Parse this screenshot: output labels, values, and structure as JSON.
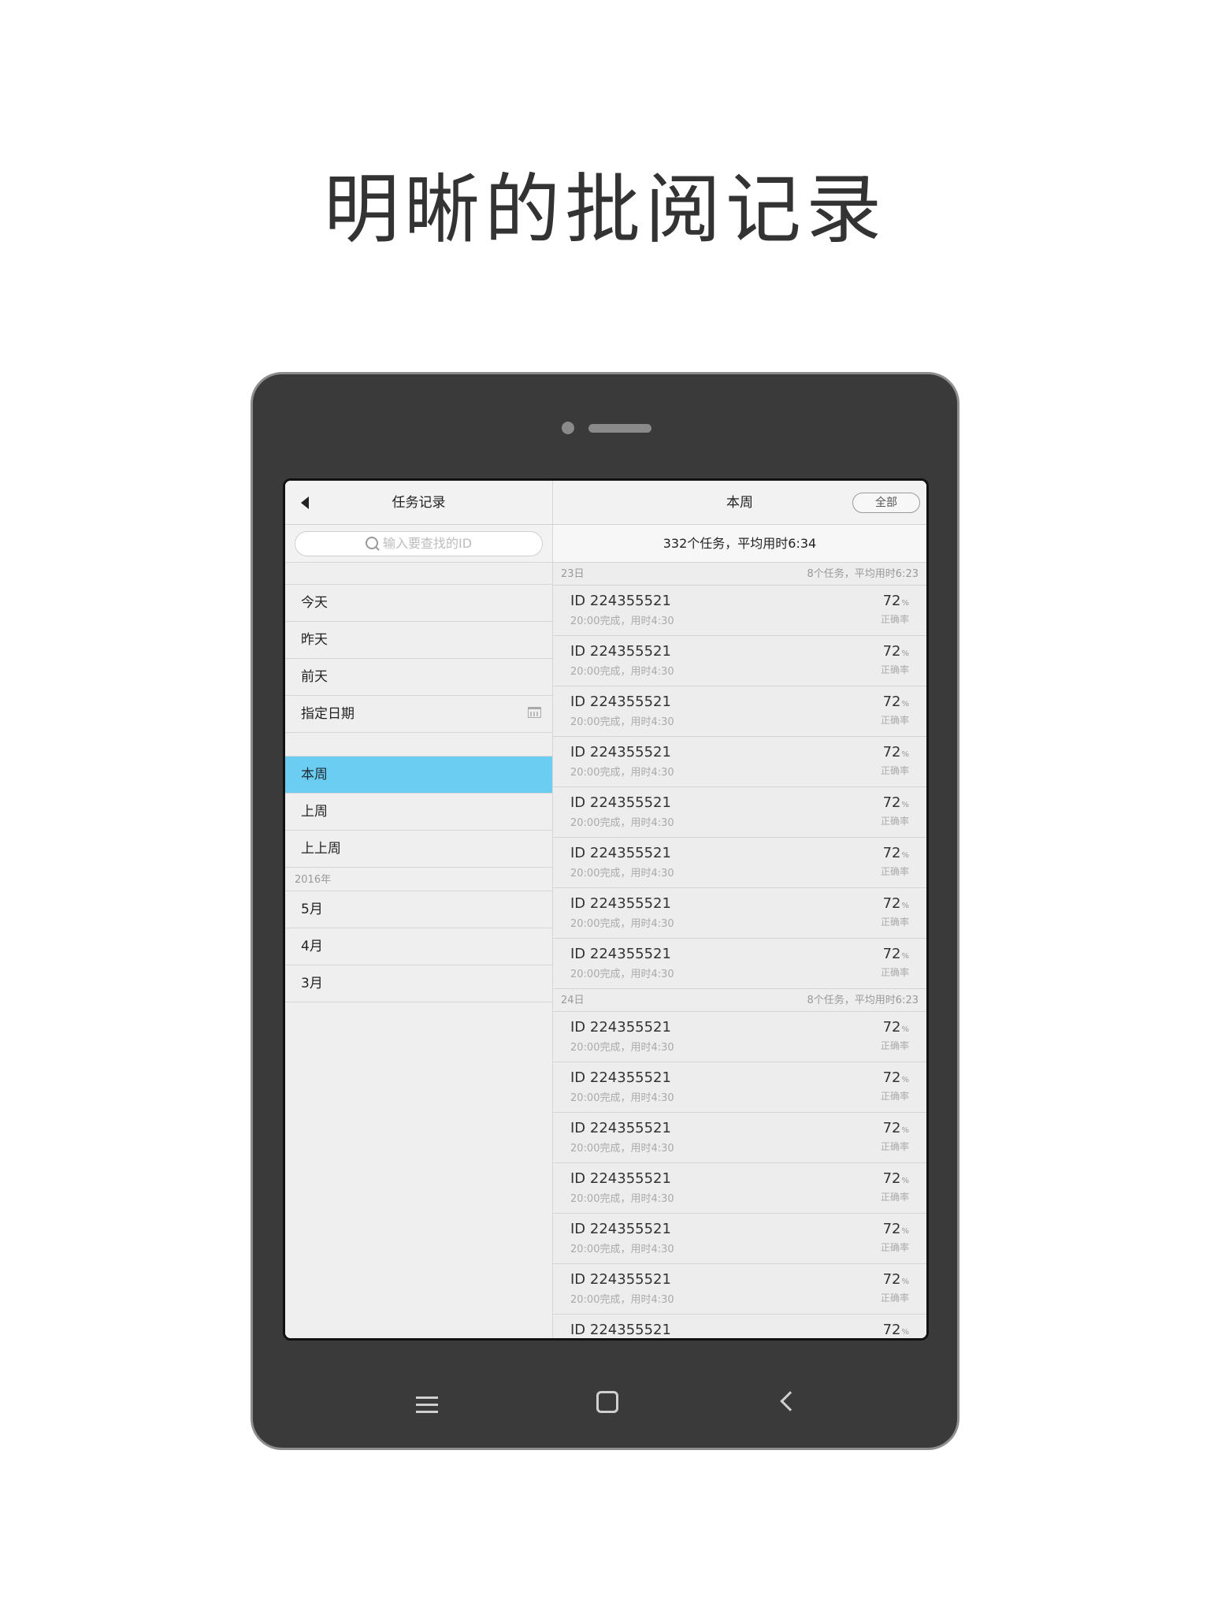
{
  "headline": "明晰的批阅记录",
  "sidebar": {
    "title": "任务记录",
    "search_placeholder": "输入要查找的ID",
    "items_recent": [
      {
        "label": "今天"
      },
      {
        "label": "昨天"
      },
      {
        "label": "前天"
      },
      {
        "label": "指定日期",
        "icon": "calendar-icon"
      }
    ],
    "items_weeks": [
      {
        "label": "本周",
        "active": true
      },
      {
        "label": "上周"
      },
      {
        "label": "上上周"
      }
    ],
    "year_header": "2016年",
    "items_months": [
      {
        "label": "5月"
      },
      {
        "label": "4月"
      },
      {
        "label": "3月"
      }
    ]
  },
  "main": {
    "title": "本周",
    "all_button": "全部",
    "summary": "332个任务，平均用时6:34",
    "groups": [
      {
        "day": "23日",
        "summary": "8个任务，平均用时6:23",
        "rows": [
          {
            "id": "ID 224355521",
            "sub": "20:00完成，用时4:30",
            "pct": "72",
            "unit": "%",
            "acc": "正确率"
          },
          {
            "id": "ID 224355521",
            "sub": "20:00完成，用时4:30",
            "pct": "72",
            "unit": "%",
            "acc": "正确率"
          },
          {
            "id": "ID 224355521",
            "sub": "20:00完成，用时4:30",
            "pct": "72",
            "unit": "%",
            "acc": "正确率"
          },
          {
            "id": "ID 224355521",
            "sub": "20:00完成，用时4:30",
            "pct": "72",
            "unit": "%",
            "acc": "正确率"
          },
          {
            "id": "ID 224355521",
            "sub": "20:00完成，用时4:30",
            "pct": "72",
            "unit": "%",
            "acc": "正确率"
          },
          {
            "id": "ID 224355521",
            "sub": "20:00完成，用时4:30",
            "pct": "72",
            "unit": "%",
            "acc": "正确率"
          },
          {
            "id": "ID 224355521",
            "sub": "20:00完成，用时4:30",
            "pct": "72",
            "unit": "%",
            "acc": "正确率"
          },
          {
            "id": "ID 224355521",
            "sub": "20:00完成，用时4:30",
            "pct": "72",
            "unit": "%",
            "acc": "正确率"
          }
        ]
      },
      {
        "day": "24日",
        "summary": "8个任务，平均用时6:23",
        "rows": [
          {
            "id": "ID 224355521",
            "sub": "20:00完成，用时4:30",
            "pct": "72",
            "unit": "%",
            "acc": "正确率"
          },
          {
            "id": "ID 224355521",
            "sub": "20:00完成，用时4:30",
            "pct": "72",
            "unit": "%",
            "acc": "正确率"
          },
          {
            "id": "ID 224355521",
            "sub": "20:00完成，用时4:30",
            "pct": "72",
            "unit": "%",
            "acc": "正确率"
          },
          {
            "id": "ID 224355521",
            "sub": "20:00完成，用时4:30",
            "pct": "72",
            "unit": "%",
            "acc": "正确率"
          },
          {
            "id": "ID 224355521",
            "sub": "20:00完成，用时4:30",
            "pct": "72",
            "unit": "%",
            "acc": "正确率"
          },
          {
            "id": "ID 224355521",
            "sub": "20:00完成，用时4:30",
            "pct": "72",
            "unit": "%",
            "acc": "正确率"
          },
          {
            "id": "ID 224355521",
            "sub": "",
            "pct": "72",
            "unit": "%",
            "acc": ""
          }
        ]
      }
    ]
  },
  "colors": {
    "active_item": "#6ccdf2",
    "device_body": "#3a3a3a",
    "screen_bg": "#efefef"
  },
  "hardware_buttons": [
    "menu-icon",
    "home-icon",
    "back-icon"
  ]
}
